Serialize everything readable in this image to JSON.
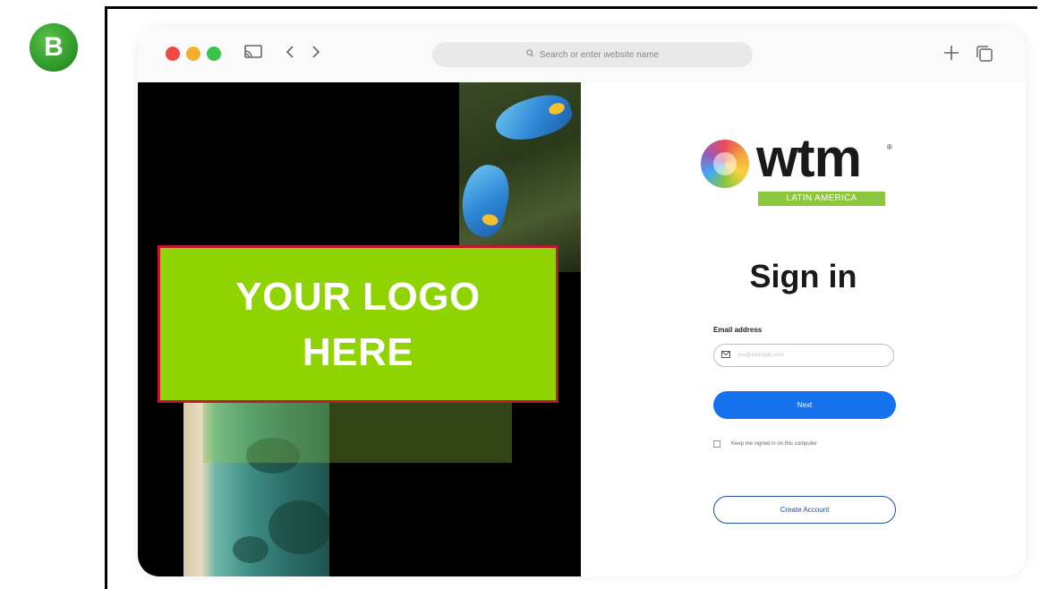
{
  "badge": {
    "letter": "B"
  },
  "browser": {
    "url_placeholder": "Search or enter website name",
    "icons": [
      "close-dot",
      "minimize-dot",
      "maximize-dot",
      "cast-icon",
      "back-icon",
      "forward-icon",
      "search-icon",
      "new-tab-icon",
      "tabs-icon"
    ]
  },
  "placeholder": {
    "line1": "YOUR LOGO",
    "line2": "HERE"
  },
  "brand": {
    "word": "wtm",
    "registered": "®",
    "subtitle": "LATIN AMERICA"
  },
  "signin": {
    "title": "Sign in",
    "email_label": "Email address",
    "email_placeholder": "you@example.com",
    "next_label": "Next",
    "keep_signed_in": "Keep me signed in on this computer",
    "create_account_label": "Create Account"
  },
  "colors": {
    "next_button": "#1671ec",
    "placeholder_bg": "#8fd400",
    "placeholder_border": "#c0162f",
    "brand_green": "#8cc63f"
  }
}
